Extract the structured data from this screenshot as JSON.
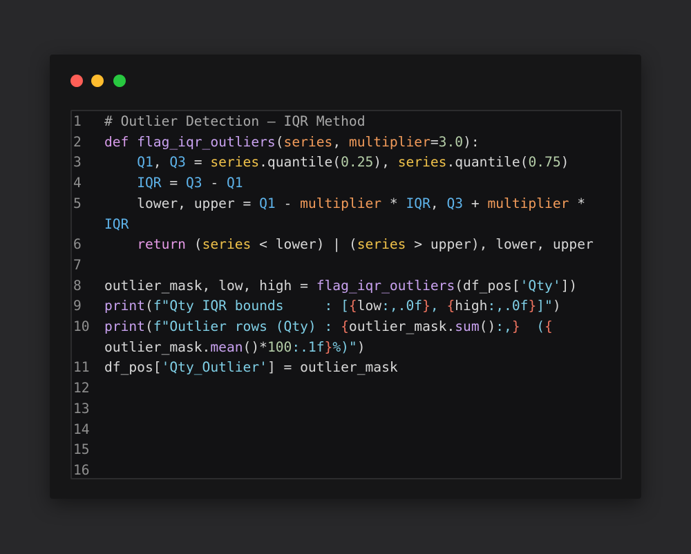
{
  "window": {
    "controls": [
      "close",
      "minimize",
      "maximize"
    ],
    "colors": {
      "close": "#ff5f57",
      "minimize": "#febc2e",
      "maximize": "#28c840"
    }
  },
  "editor": {
    "line_numbers": [
      "1",
      "2",
      "3",
      "4",
      "5",
      "",
      "6",
      "7",
      "8",
      "9",
      "10",
      "",
      "11",
      "12",
      "13",
      "14",
      "15",
      "16"
    ],
    "lines": [
      [
        {
          "t": "# Outlier Detection — IQR Method",
          "c": "comment"
        }
      ],
      [
        {
          "t": "def ",
          "c": "kw"
        },
        {
          "t": "flag_iqr_outliers",
          "c": "fn"
        },
        {
          "t": "(",
          "c": "plain"
        },
        {
          "t": "series",
          "c": "par"
        },
        {
          "t": ", ",
          "c": "plain"
        },
        {
          "t": "multiplier",
          "c": "par"
        },
        {
          "t": "=",
          "c": "plain"
        },
        {
          "t": "3.0",
          "c": "num"
        },
        {
          "t": "):",
          "c": "plain"
        }
      ],
      [
        {
          "t": "    ",
          "c": "plain"
        },
        {
          "t": "Q1",
          "c": "cls"
        },
        {
          "t": ", ",
          "c": "plain"
        },
        {
          "t": "Q3",
          "c": "cls"
        },
        {
          "t": " = ",
          "c": "plain"
        },
        {
          "t": "series",
          "c": "var"
        },
        {
          "t": ".quantile(",
          "c": "plain"
        },
        {
          "t": "0.25",
          "c": "num"
        },
        {
          "t": "), ",
          "c": "plain"
        },
        {
          "t": "series",
          "c": "var"
        },
        {
          "t": ".quantile(",
          "c": "plain"
        },
        {
          "t": "0.75",
          "c": "num"
        },
        {
          "t": ")",
          "c": "plain"
        }
      ],
      [
        {
          "t": "    ",
          "c": "plain"
        },
        {
          "t": "IQR",
          "c": "cls"
        },
        {
          "t": " = ",
          "c": "plain"
        },
        {
          "t": "Q3",
          "c": "cls"
        },
        {
          "t": " - ",
          "c": "plain"
        },
        {
          "t": "Q1",
          "c": "cls"
        }
      ],
      [
        {
          "t": "    lower, upper = ",
          "c": "plain"
        },
        {
          "t": "Q1",
          "c": "cls"
        },
        {
          "t": " - ",
          "c": "plain"
        },
        {
          "t": "multiplier",
          "c": "par"
        },
        {
          "t": " * ",
          "c": "plain"
        },
        {
          "t": "IQR",
          "c": "cls"
        },
        {
          "t": ", ",
          "c": "plain"
        },
        {
          "t": "Q3",
          "c": "cls"
        },
        {
          "t": " + ",
          "c": "plain"
        },
        {
          "t": "multiplier",
          "c": "par"
        },
        {
          "t": " *",
          "c": "plain"
        }
      ],
      [
        {
          "t": "IQR",
          "c": "cls"
        }
      ],
      [
        {
          "t": "    ",
          "c": "plain"
        },
        {
          "t": "return",
          "c": "kwr"
        },
        {
          "t": " (",
          "c": "plain"
        },
        {
          "t": "series",
          "c": "var"
        },
        {
          "t": " < lower) | (",
          "c": "plain"
        },
        {
          "t": "series",
          "c": "var"
        },
        {
          "t": " > upper), lower, upper",
          "c": "plain"
        }
      ],
      [],
      [
        {
          "t": "outlier_mask, low, high = ",
          "c": "plain"
        },
        {
          "t": "flag_iqr_outliers",
          "c": "fn"
        },
        {
          "t": "(df_pos[",
          "c": "plain"
        },
        {
          "t": "'Qty'",
          "c": "str"
        },
        {
          "t": "])",
          "c": "plain"
        }
      ],
      [
        {
          "t": "print",
          "c": "fn"
        },
        {
          "t": "(",
          "c": "plain"
        },
        {
          "t": "f\"Qty IQR bounds     : [",
          "c": "str"
        },
        {
          "t": "{",
          "c": "brace"
        },
        {
          "t": "low",
          "c": "plain"
        },
        {
          "t": ":,.0f",
          "c": "str"
        },
        {
          "t": "}",
          "c": "brace"
        },
        {
          "t": ", ",
          "c": "str"
        },
        {
          "t": "{",
          "c": "brace"
        },
        {
          "t": "high",
          "c": "plain"
        },
        {
          "t": ":,.0f",
          "c": "str"
        },
        {
          "t": "}",
          "c": "brace"
        },
        {
          "t": "]\"",
          "c": "str"
        },
        {
          "t": ")",
          "c": "plain"
        }
      ],
      [
        {
          "t": "print",
          "c": "fn"
        },
        {
          "t": "(",
          "c": "plain"
        },
        {
          "t": "f\"Outlier rows (Qty) : ",
          "c": "str"
        },
        {
          "t": "{",
          "c": "brace"
        },
        {
          "t": "outlier_mask.",
          "c": "plain"
        },
        {
          "t": "sum",
          "c": "fn"
        },
        {
          "t": "()",
          "c": "plain"
        },
        {
          "t": ":,",
          "c": "str"
        },
        {
          "t": "}",
          "c": "brace"
        },
        {
          "t": "  (",
          "c": "str"
        },
        {
          "t": "{",
          "c": "brace"
        }
      ],
      [
        {
          "t": "outlier_mask.",
          "c": "plain"
        },
        {
          "t": "mean",
          "c": "fn"
        },
        {
          "t": "()*",
          "c": "plain"
        },
        {
          "t": "100",
          "c": "num"
        },
        {
          "t": ":.1f",
          "c": "str"
        },
        {
          "t": "}",
          "c": "brace"
        },
        {
          "t": "%)\"",
          "c": "str"
        },
        {
          "t": ")",
          "c": "plain"
        }
      ],
      [
        {
          "t": "df_pos[",
          "c": "plain"
        },
        {
          "t": "'Qty_Outlier'",
          "c": "str"
        },
        {
          "t": "] = outlier_mask",
          "c": "plain"
        }
      ],
      [],
      [],
      [],
      [],
      []
    ]
  }
}
